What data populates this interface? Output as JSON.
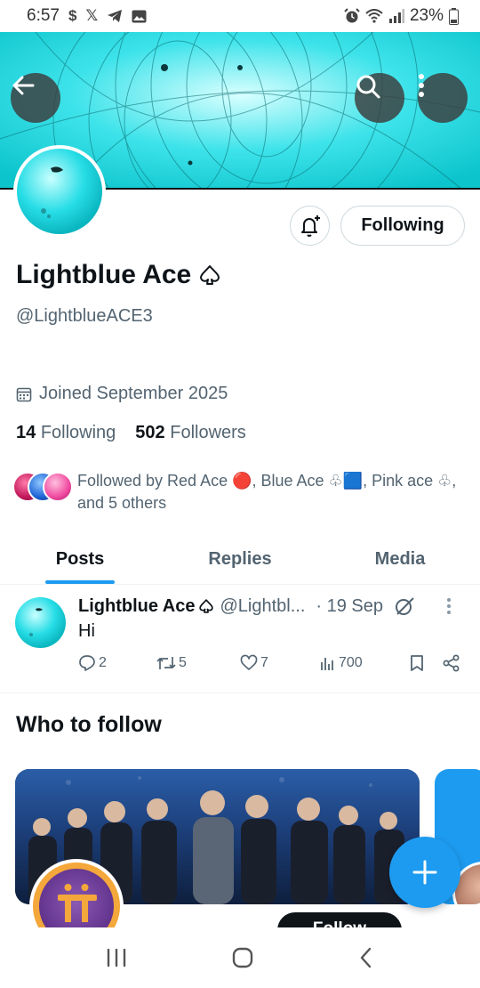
{
  "status_bar": {
    "time": "6:57",
    "battery": "23%",
    "left_icons": [
      "dollar-icon",
      "x-icon",
      "telegram-icon",
      "gallery-icon"
    ],
    "right_icons": [
      "alarm-icon",
      "wifi-icon",
      "signal-icon",
      "battery-icon"
    ]
  },
  "profile": {
    "name": "Lightblue Ace",
    "name_suffix_icon": "spade-icon",
    "handle": "@LightblueACE3",
    "joined": "Joined September 2025",
    "following_count": "14",
    "following_label": "Following",
    "followers_count": "502",
    "followers_label": "Followers",
    "followed_by": "Followed by Red Ace 🔴, Blue Ace ♧🟦, Pink ace ♧, and 5 others",
    "follow_button_label": "Following"
  },
  "tabs": [
    {
      "label": "Posts",
      "active": true
    },
    {
      "label": "Replies",
      "active": false
    },
    {
      "label": "Media",
      "active": false
    }
  ],
  "post": {
    "author": "Lightblue Ace",
    "handle": "@Lightbl...",
    "time": "· 19 Sep",
    "text": "Hi",
    "replies": "2",
    "reposts": "5",
    "likes": "7",
    "views": "700"
  },
  "who_to_follow": {
    "title": "Who to follow",
    "follow_button_label": "Follow"
  },
  "colors": {
    "accent": "#1d9bf0",
    "banner": "#19d6dd",
    "text": "#0f1419",
    "secondary": "#536471"
  }
}
